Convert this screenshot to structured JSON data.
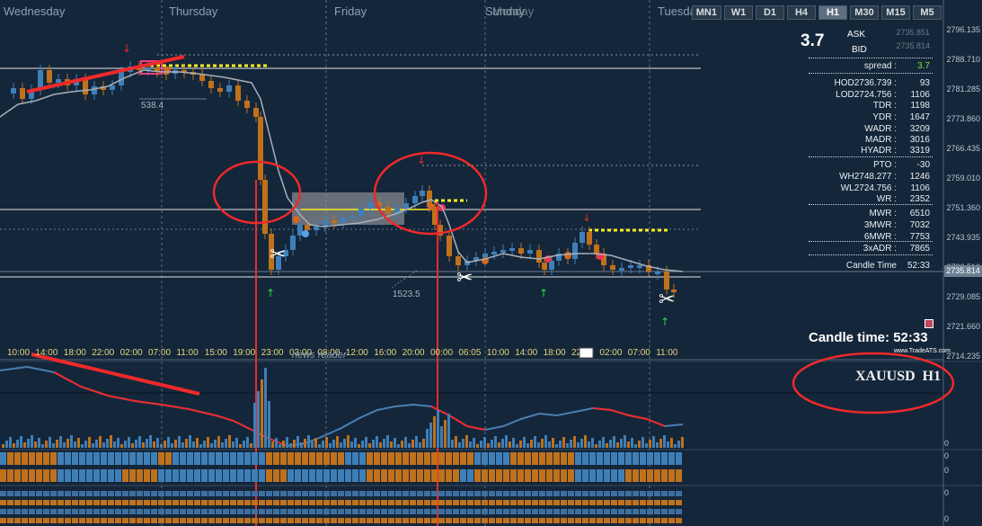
{
  "days": [
    "Wednesday",
    "Thursday",
    "Friday",
    "Monday",
    "Tuesday"
  ],
  "symbol_overlay": "Sunday",
  "timeframes": [
    "MN1",
    "W1",
    "D1",
    "H4",
    "H1",
    "M30",
    "M15",
    "M5"
  ],
  "active_timeframe": "H1",
  "spread_big": "3.7",
  "ask_label": "ASK",
  "bid_label": "BID",
  "ask_value": "2735.851",
  "bid_value": "2735.814",
  "stats": [
    {
      "label": "spread :",
      "value": "3.7"
    },
    {
      "label": "HOD2736.739 :",
      "value": "93"
    },
    {
      "label": "LOD2724.756 :",
      "value": "1106"
    },
    {
      "label": "TDR :",
      "value": "1198"
    },
    {
      "label": "YDR :",
      "value": "1647"
    },
    {
      "label": "WADR :",
      "value": "3209"
    },
    {
      "label": "MADR :",
      "value": "3016"
    },
    {
      "label": "HYADR :",
      "value": "3319"
    },
    {
      "label": "PTO :",
      "value": "-30"
    },
    {
      "label": "WH2748.277 :",
      "value": "1246"
    },
    {
      "label": "WL2724.756 :",
      "value": "1106"
    },
    {
      "label": "WR :",
      "value": "2352"
    },
    {
      "label": "MWR :",
      "value": "6510"
    },
    {
      "label": "3MWR :",
      "value": "7032"
    },
    {
      "label": "6MWR :",
      "value": "7753"
    },
    {
      "label": "3xADR :",
      "value": "7865"
    },
    {
      "label": "Candle Time",
      "value": "52:33"
    }
  ],
  "candle_time_label": "Candle time:",
  "candle_time_value": "52:33",
  "brand": "www.TradeATS.com",
  "symbol_label": "XAUUSD  H1",
  "price_ticks": [
    "2796.135",
    "2788.710",
    "2781.285",
    "2773.860",
    "2766.435",
    "2759.010",
    "2751.360",
    "2743.935",
    "2736.510",
    "2729.085",
    "2721.660",
    "2714.235"
  ],
  "current_price": "2735.814",
  "time_ticks": [
    "10:00",
    "14:00",
    "18:00",
    "22:00",
    "02:00",
    "07:00",
    "11:00",
    "15:00",
    "19:00",
    "23:00",
    "03:00",
    "08:00",
    "12:00",
    "16:00",
    "20:00",
    "00:00",
    "06:05",
    "10:00",
    "14:00",
    "18:00",
    "22:00",
    "02:00",
    "07:00",
    "11:00"
  ],
  "news_reader": "news reader",
  "range_labels": [
    "538.4",
    "1523.5"
  ],
  "sub_zero": "0",
  "sub_ticks": [
    "0",
    "0",
    "0",
    "0",
    "0"
  ]
}
